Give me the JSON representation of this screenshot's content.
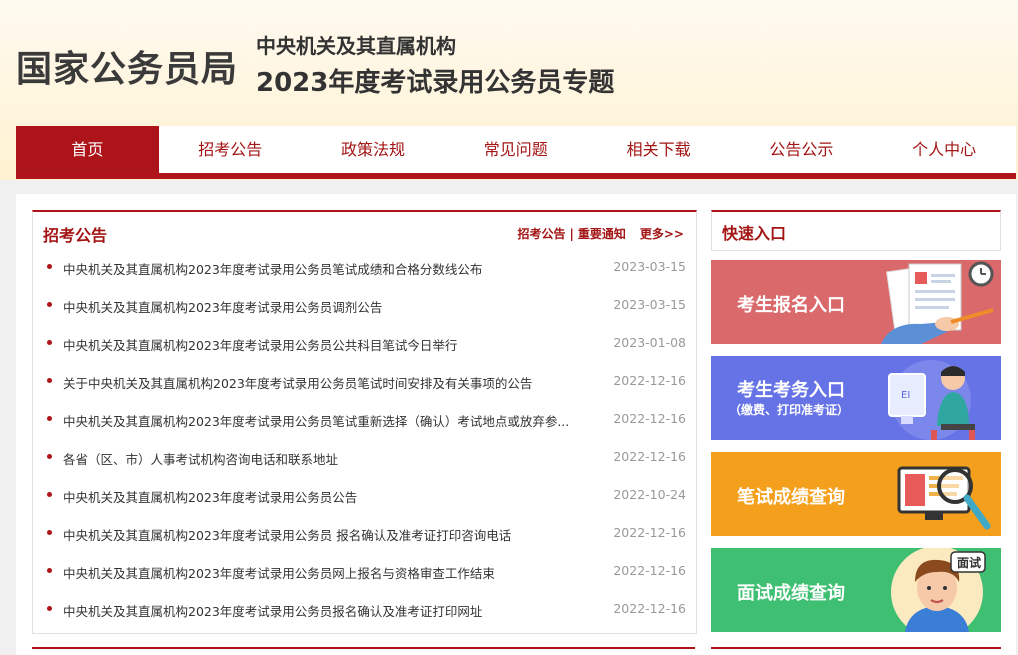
{
  "header": {
    "logo": "国家公务员局",
    "subtitle": "中央机关及其直属机构",
    "title": "2023年度考试录用公务员专题"
  },
  "nav": {
    "items": [
      "首页",
      "招考公告",
      "政策法规",
      "常见问题",
      "相关下载",
      "公告公示",
      "个人中心"
    ],
    "active": "首页"
  },
  "news": {
    "title": "招考公告",
    "link1": "招考公告",
    "separator": "|",
    "link2": "重要通知",
    "more": "更多>>",
    "items": [
      {
        "title": "中央机关及其直属机构2023年度考试录用公务员笔试成绩和合格分数线公布",
        "date": "2023-03-15"
      },
      {
        "title": "中央机关及其直属机构2023年度考试录用公务员调剂公告",
        "date": "2023-03-15"
      },
      {
        "title": "中央机关及其直属机构2023年度考试录用公务员公共科目笔试今日举行",
        "date": "2023-01-08"
      },
      {
        "title": "关于中央机关及其直属机构2023年度考试录用公务员笔试时间安排及有关事项的公告",
        "date": "2022-12-16"
      },
      {
        "title": "中央机关及其直属机构2023年度考试录用公务员笔试重新选择（确认）考试地点或放弃参...",
        "date": "2022-12-16"
      },
      {
        "title": "各省（区、市）人事考试机构咨询电话和联系地址",
        "date": "2022-12-16"
      },
      {
        "title": "中央机关及其直属机构2023年度考试录用公务员公告",
        "date": "2022-10-24"
      },
      {
        "title": "中央机关及其直属机构2023年度考试录用公务员 报名确认及准考证打印咨询电话",
        "date": "2022-12-16"
      },
      {
        "title": "中央机关及其直属机构2023年度考试录用公务员网上报名与资格审查工作结束",
        "date": "2022-12-16"
      },
      {
        "title": "中央机关及其直属机构2023年度考试录用公务员报名确认及准考证打印网址",
        "date": "2022-12-16"
      }
    ]
  },
  "quick": {
    "title": "快速入口",
    "cards": [
      {
        "label": "考生报名入口",
        "note": "",
        "color": "#d9696b",
        "icon": "application-form-icon"
      },
      {
        "label": "考生考务入口",
        "note": "（缴费、打印准考证）",
        "color": "#6673e6",
        "icon": "computer-user-icon"
      },
      {
        "label": "笔试成绩查询",
        "note": "",
        "color": "#f5a01d",
        "icon": "magnifier-screen-icon"
      },
      {
        "label": "面试成绩查询",
        "note": "",
        "color": "#3fbf72",
        "icon": "interview-person-icon"
      }
    ],
    "interview_badge": "面试"
  },
  "colors": {
    "accent": "#b0141a",
    "header_bg": "#fff5dc"
  }
}
